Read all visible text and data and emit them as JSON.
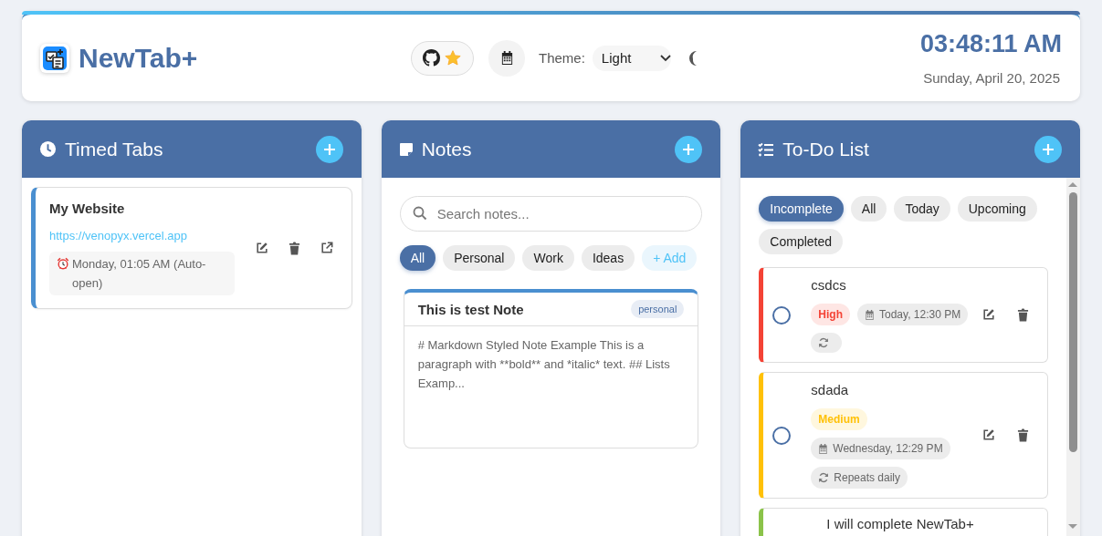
{
  "header": {
    "app_title": "NewTab+",
    "theme_label": "Theme:",
    "theme_value": "Light",
    "time": "03:48:11 AM",
    "date": "Sunday, April 20, 2025"
  },
  "timed_tabs": {
    "title": "Timed Tabs",
    "tabs": [
      {
        "title": "My Website",
        "url": "https://venopyx.vercel.app",
        "schedule": "Monday, 01:05 AM (Auto-open)"
      }
    ]
  },
  "notes": {
    "title": "Notes",
    "search": {
      "placeholder": "Search notes..."
    },
    "filters": [
      {
        "label": "All",
        "kind": "filter",
        "selected": true
      },
      {
        "label": "Personal",
        "kind": "filter",
        "selected": false
      },
      {
        "label": "Work",
        "kind": "filter",
        "selected": false
      },
      {
        "label": "Ideas",
        "kind": "filter",
        "selected": false
      },
      {
        "label": "+ Add",
        "kind": "add",
        "selected": false
      }
    ],
    "notes": [
      {
        "title": "This is test Note",
        "tag": "personal",
        "body": "# Markdown Styled Note Example This is a paragraph with **bold** and *italic* text. ## Lists Examp..."
      }
    ]
  },
  "todo": {
    "title": "To-Do List",
    "filters": [
      {
        "label": "Incomplete",
        "selected": true
      },
      {
        "label": "All",
        "selected": false
      },
      {
        "label": "Today",
        "selected": false
      },
      {
        "label": "Upcoming",
        "selected": false
      },
      {
        "label": "Completed",
        "selected": false
      }
    ],
    "tasks": [
      {
        "title": "csdcs",
        "color": "#f44336",
        "priority": "High",
        "due": "Today, 12:30 PM",
        "repeats": true,
        "completed": false
      },
      {
        "title": "sdada",
        "color": "#ffc107",
        "priority": "Medium",
        "due": "Wednesday, 12:29 PM",
        "repeats": true,
        "repeat_label": "Repeats daily",
        "completed": false
      },
      {
        "title": "I will complete NewTab+",
        "color": "#8bc34a"
      }
    ]
  }
}
